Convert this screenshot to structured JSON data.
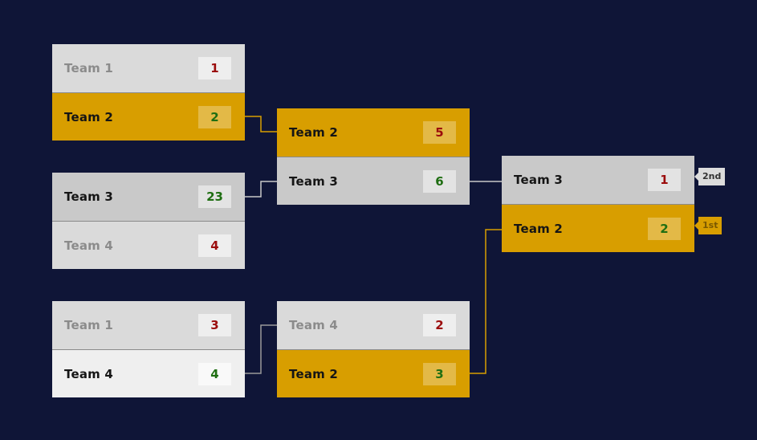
{
  "bracket": {
    "colors": {
      "background": "#0f1537",
      "winner": "#d89e00",
      "score_win": "#1f6e12",
      "score_lose": "#9b0c0c",
      "connector_gold": "#d89e00",
      "connector_gray": "#c8c8c8"
    },
    "matches": [
      {
        "id": "r1m1",
        "round": 1,
        "teams": [
          {
            "name": "Team 1",
            "score": "1",
            "state": "loser",
            "result": "lose"
          },
          {
            "name": "Team 2",
            "score": "2",
            "state": "winner",
            "result": "win"
          }
        ]
      },
      {
        "id": "r1m2",
        "round": 1,
        "teams": [
          {
            "name": "Team 3",
            "score": "23",
            "state": "mid",
            "result": "win"
          },
          {
            "name": "Team 4",
            "score": "4",
            "state": "loser",
            "result": "lose"
          }
        ]
      },
      {
        "id": "r1m3",
        "round": 1,
        "teams": [
          {
            "name": "Team 1",
            "score": "3",
            "state": "loser",
            "result": "lose"
          },
          {
            "name": "Team 4",
            "score": "4",
            "state": "light",
            "result": "win"
          }
        ]
      },
      {
        "id": "r2m1",
        "round": 2,
        "teams": [
          {
            "name": "Team 2",
            "score": "5",
            "state": "winner",
            "result": "lose"
          },
          {
            "name": "Team 3",
            "score": "6",
            "state": "mid",
            "result": "win"
          }
        ]
      },
      {
        "id": "r2m2",
        "round": 2,
        "teams": [
          {
            "name": "Team 4",
            "score": "2",
            "state": "loser",
            "result": "lose"
          },
          {
            "name": "Team 2",
            "score": "3",
            "state": "winner",
            "result": "win"
          }
        ]
      },
      {
        "id": "final",
        "round": 3,
        "teams": [
          {
            "name": "Team 3",
            "score": "1",
            "state": "mid",
            "result": "lose"
          },
          {
            "name": "Team 2",
            "score": "2",
            "state": "winner",
            "result": "win"
          }
        ]
      }
    ],
    "placements": [
      {
        "label": "2nd",
        "style": "second"
      },
      {
        "label": "1st",
        "style": "first"
      }
    ]
  }
}
